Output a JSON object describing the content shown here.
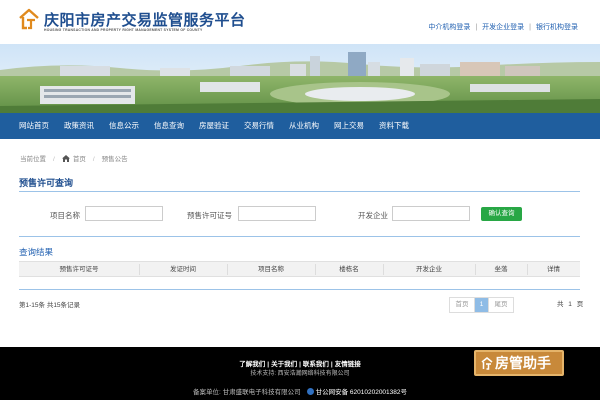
{
  "header": {
    "title": "庆阳市房产交易监管服务平台",
    "subtitle": "HOUSING TRANSACTION AND PROPERTY RIGHT MANAGEMENT SYSTEM OF COUNTY",
    "links": [
      "中介机构登录",
      "开发企业登录",
      "银行机构登录"
    ],
    "separator": "|"
  },
  "nav": {
    "items": [
      "网站首页",
      "政策资讯",
      "信息公示",
      "信息查询",
      "房屋验证",
      "交易行情",
      "从业机构",
      "网上交易",
      "资料下载"
    ]
  },
  "breadcrumb": {
    "current_label": "当前位置",
    "home": "首页",
    "page": "预售公告",
    "separator": "/"
  },
  "query": {
    "section_title": "预售许可查询",
    "fields": [
      {
        "label": "项目名称",
        "value": ""
      },
      {
        "label": "预售许可证号",
        "value": ""
      },
      {
        "label": "开发企业",
        "value": ""
      }
    ],
    "search_button": "确认查询"
  },
  "results": {
    "title": "查询结果",
    "columns": [
      "预售许可证号",
      "发证时间",
      "项目名称",
      "楼栋名",
      "开发企业",
      "坐落",
      "详情"
    ],
    "rows": [],
    "count_text": "第1-15条  共15条记录"
  },
  "pagination": {
    "first": "首页",
    "current": "1",
    "last": "尾页",
    "total_text": "共 1 页"
  },
  "footer": {
    "links": [
      "了解我们",
      "关于我们",
      "联系我们",
      "友情链接"
    ],
    "link_separator": "|",
    "tech_support": "技术支持: 西安浩瀚网络科技有限公司",
    "record_org": "备案单位: 甘肃盛联电子科技有限公司",
    "public_security": "甘公网安备 62010202001382号"
  },
  "float_button": {
    "label": "房管助手"
  },
  "colors": {
    "brand_blue": "#1f4e8f",
    "nav_bg": "#1f5e9e",
    "search_green": "#28a745",
    "accent_light_blue": "#9cc3e8",
    "footer_bg": "#000000",
    "float_button_bg": "#c8893a"
  }
}
